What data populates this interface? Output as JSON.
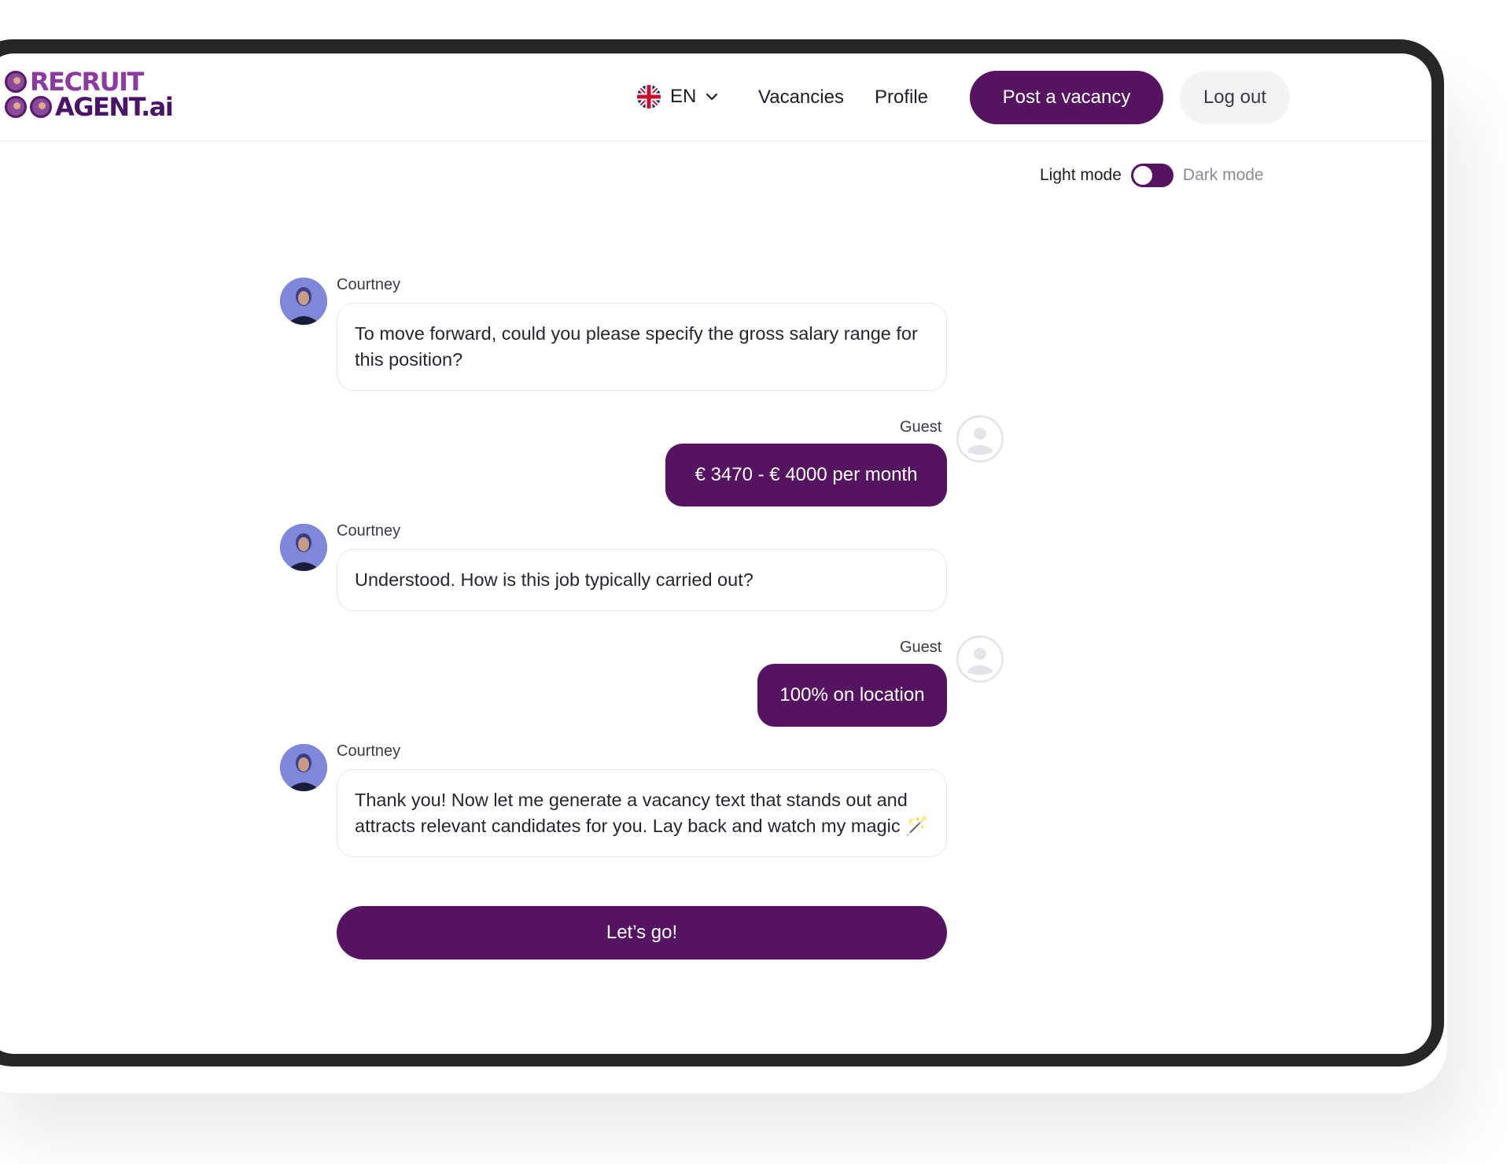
{
  "brand": {
    "line1": "RECRUIT",
    "line2": "AGENT.ai"
  },
  "header": {
    "language": {
      "code": "EN",
      "flag_icon": "uk-flag-icon"
    },
    "nav": {
      "vacancies": "Vacancies",
      "profile": "Profile"
    },
    "post_button": "Post a vacancy",
    "logout_button": "Log out"
  },
  "theme": {
    "light_label": "Light mode",
    "dark_label": "Dark mode",
    "mode": "light"
  },
  "chat": {
    "messages": [
      {
        "sender": "Courtney",
        "role": "agent",
        "text": "To move forward, could you please specify the gross salary range for this position?"
      },
      {
        "sender": "Guest",
        "role": "user",
        "text": "€ 3470 - € 4000 per month"
      },
      {
        "sender": "Courtney",
        "role": "agent",
        "text": "Understood. How is this job typically carried out?"
      },
      {
        "sender": "Guest",
        "role": "user",
        "text": "100% on location"
      },
      {
        "sender": "Courtney",
        "role": "agent",
        "text": "Thank you! Now let me generate a vacancy text that stands out and attracts relevant candidates for you. Lay back and watch my magic 🪄"
      }
    ],
    "cta": "Let’s go!"
  },
  "colors": {
    "accent": "#55145f",
    "brand_light": "#8b3aa0",
    "frame": "#262626"
  }
}
